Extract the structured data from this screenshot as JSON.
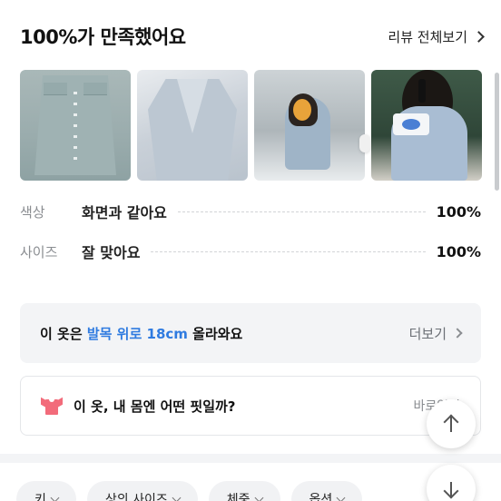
{
  "header": {
    "title": "100%가 만족했어요",
    "review_all_label": "리뷰 전체보기"
  },
  "photos": [
    {
      "icon": "skirt-photo"
    },
    {
      "icon": "jacket-photo"
    },
    {
      "icon": "mirror-selfie-photo"
    },
    {
      "icon": "presenter-photo"
    }
  ],
  "ratings": [
    {
      "label": "색상",
      "value": "화면과 같아요",
      "percent": "100%"
    },
    {
      "label": "사이즈",
      "value": "잘 맞아요",
      "percent": "100%"
    }
  ],
  "height_info": {
    "prefix": "이 옷은",
    "highlight": "발목 위로 18cm",
    "suffix": "올라와요",
    "more_label": "더보기",
    "highlight_color": "#2f7be0"
  },
  "fit": {
    "text": "이 옷, 내 몸엔 어떤 핏일까?",
    "goto_label": "바로입기",
    "icon_color": "#f26b7a"
  },
  "filter_chips": [
    {
      "label": "키"
    },
    {
      "label": "상의 사이즈"
    },
    {
      "label": "체중"
    },
    {
      "label": "옵션"
    }
  ]
}
